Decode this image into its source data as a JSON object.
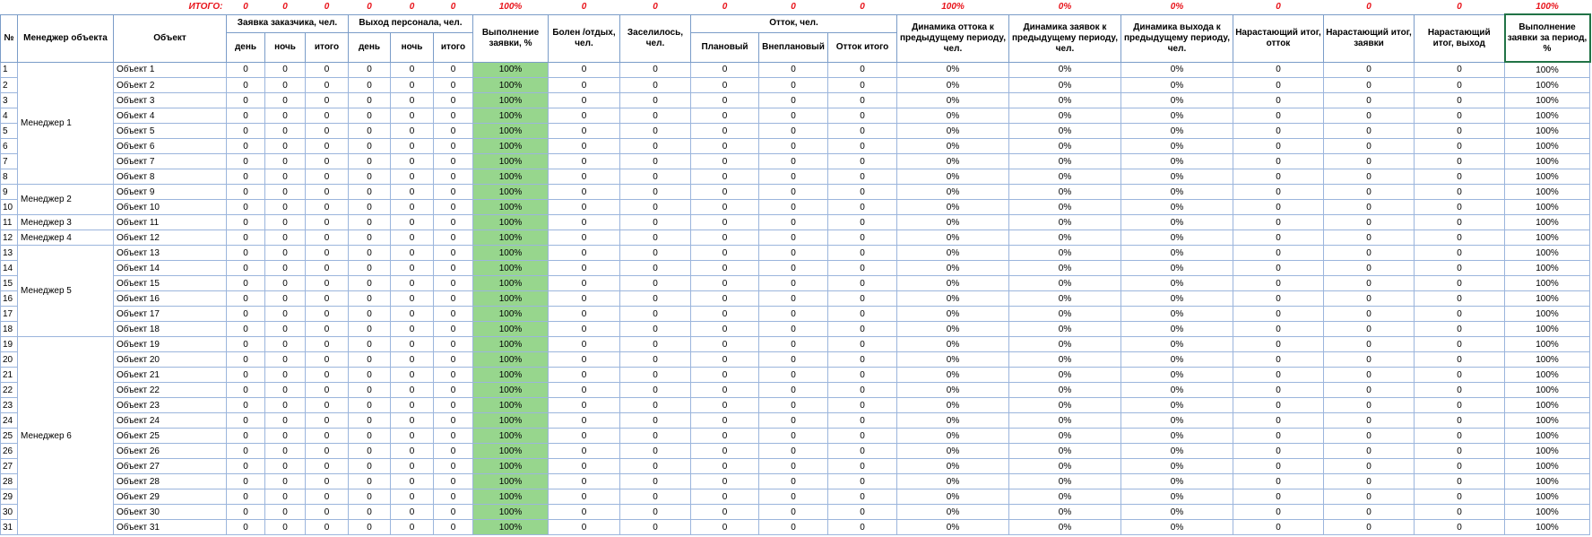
{
  "colors": {
    "accent_red": "#e8141b",
    "fill_green": "#97d68d",
    "grid_blue": "#9bb5dc"
  },
  "totals": {
    "label": "ИТОГО:",
    "values": [
      "0",
      "0",
      "0",
      "0",
      "0",
      "0",
      "100%",
      "0",
      "0",
      "0",
      "0",
      "0",
      "100%",
      "0%",
      "0%",
      "0",
      "0",
      "0",
      "100%"
    ]
  },
  "headers": {
    "num": "№",
    "manager": "Менеджер объекта",
    "object": "Объект",
    "request_group": "Заявка заказчика, чел.",
    "exit_group": "Выход персонала, чел.",
    "sub_day": "день",
    "sub_night": "ночь",
    "sub_total": "итого",
    "fulfillment": "Выполнение заявки, %",
    "sick": "Болен /отдых, чел.",
    "settled": "Заселилось, чел.",
    "outflow_group": "Отток, чел.",
    "planned": "Плановый",
    "unplanned": "Внеплановый",
    "outflow_total": "Отток итого",
    "dyn_outflow": "Динамика оттока к предыдущему периоду, чел.",
    "dyn_requests": "Динамика заявок к предыдущему периоду, чел.",
    "dyn_exit": "Динамика выхода к предыдущему периоду, чел.",
    "cum_outflow": "Нарастающий итог, отток",
    "cum_requests": "Нарастающий итог, заявки",
    "cum_exit": "Нарастающий итог, выход",
    "period_fulfillment": "Выполнение заявки за период, %"
  },
  "managers": [
    {
      "name": "Менеджер 1",
      "rows": 8
    },
    {
      "name": "Менеджер 2",
      "rows": 2
    },
    {
      "name": "Менеджер 3",
      "rows": 1
    },
    {
      "name": "Менеджер 4",
      "rows": 1
    },
    {
      "name": "Менеджер 5",
      "rows": 6
    },
    {
      "name": "Менеджер 6",
      "rows": 13
    }
  ],
  "rows": [
    {
      "num": "1",
      "object": "Объект 1"
    },
    {
      "num": "2",
      "object": "Объект 2"
    },
    {
      "num": "3",
      "object": "Объект 3"
    },
    {
      "num": "4",
      "object": "Объект 4"
    },
    {
      "num": "5",
      "object": "Объект 5"
    },
    {
      "num": "6",
      "object": "Объект 6"
    },
    {
      "num": "7",
      "object": "Объект 7"
    },
    {
      "num": "8",
      "object": "Объект 8"
    },
    {
      "num": "9",
      "object": "Объект 9"
    },
    {
      "num": "10",
      "object": "Объект 10"
    },
    {
      "num": "11",
      "object": "Объект 11"
    },
    {
      "num": "12",
      "object": "Объект 12"
    },
    {
      "num": "13",
      "object": "Объект 13"
    },
    {
      "num": "14",
      "object": "Объект 14"
    },
    {
      "num": "15",
      "object": "Объект 15"
    },
    {
      "num": "16",
      "object": "Объект 16"
    },
    {
      "num": "17",
      "object": "Объект 17"
    },
    {
      "num": "18",
      "object": "Объект 18"
    },
    {
      "num": "19",
      "object": "Объект 19"
    },
    {
      "num": "20",
      "object": "Объект 20"
    },
    {
      "num": "21",
      "object": "Объект 21"
    },
    {
      "num": "22",
      "object": "Объект 22"
    },
    {
      "num": "23",
      "object": "Объект 23"
    },
    {
      "num": "24",
      "object": "Объект 24"
    },
    {
      "num": "25",
      "object": "Объект 25"
    },
    {
      "num": "26",
      "object": "Объект 26"
    },
    {
      "num": "27",
      "object": "Объект 27"
    },
    {
      "num": "28",
      "object": "Объект 28"
    },
    {
      "num": "29",
      "object": "Объект 29"
    },
    {
      "num": "30",
      "object": "Объект 30"
    },
    {
      "num": "31",
      "object": "Объект 31"
    }
  ],
  "row_values": [
    "0",
    "0",
    "0",
    "0",
    "0",
    "0",
    "100%",
    "0",
    "0",
    "0",
    "0",
    "0",
    "0%",
    "0%",
    "0%",
    "0",
    "0",
    "0",
    "100%"
  ]
}
